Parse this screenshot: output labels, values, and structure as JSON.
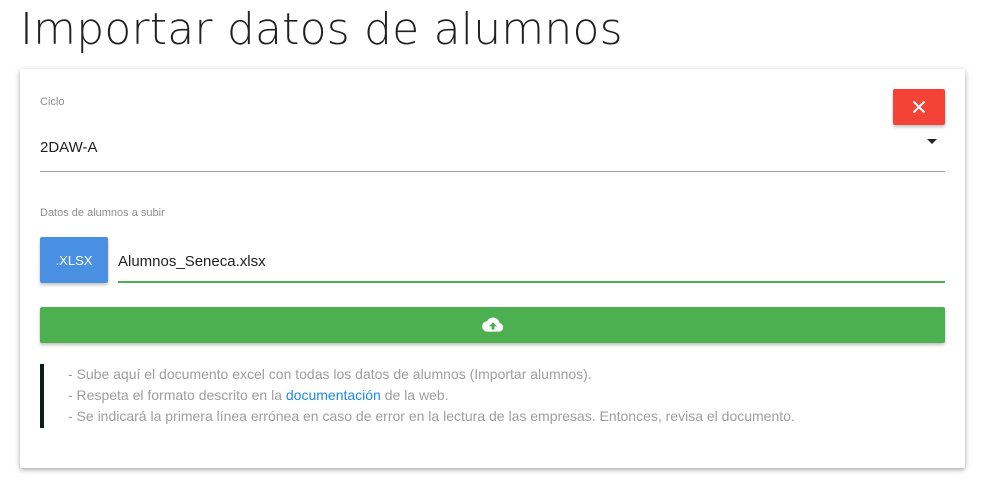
{
  "page": {
    "title": "Importar datos de alumnos"
  },
  "form": {
    "ciclo_label": "Ciclo",
    "ciclo_value": "2DAW-A",
    "datos_label": "Datos de alumnos a subir",
    "file_button_label": ".XLSX",
    "file_name": "Alumnos_Seneca.xlsx"
  },
  "notes": {
    "line1": "- Sube aquí el documento excel con todas los datos de alumnos (Importar alumnos).",
    "line2_prefix": "- Respeta el formato descrito en la ",
    "line2_link": "documentación",
    "line2_suffix": " de la web.",
    "line3": "- Se indicará la primera línea errónea en caso de error en la lectura de las empresas. Entonces, revisa el documento."
  },
  "icons": {
    "close": "close-icon",
    "upload": "cloud-upload-icon",
    "caret": "caret-down-icon"
  },
  "colors": {
    "close_button": "#f44336",
    "file_button": "#4a90e2",
    "upload_button": "#4caf50",
    "link": "#1e88e5",
    "notes_border": "#0d1b1e"
  }
}
